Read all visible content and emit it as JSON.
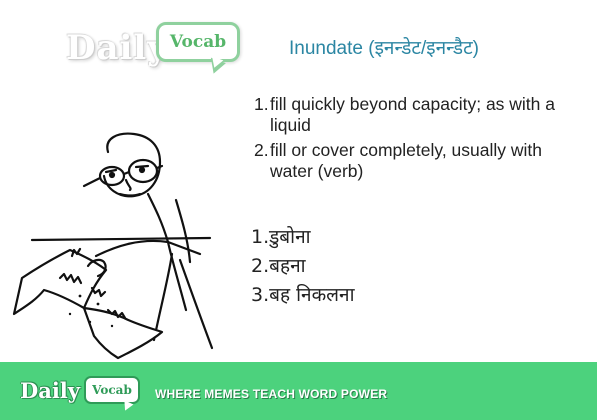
{
  "brand": {
    "daily": "Daily",
    "vocab": "Vocab",
    "tagline": "WHERE MEMES TEACH WORD POWER"
  },
  "headword": "Inundate (इनन्डेट/इनन्डैट)",
  "definitions": [
    {
      "num": "1.",
      "text": "fill quickly beyond capacity; as with a liquid"
    },
    {
      "num": "2.",
      "text": "fill or cover completely, usually with water (verb)"
    }
  ],
  "hindi_meanings": [
    "1.डुबोना",
    "2.बहना",
    "3.बह  निकलना"
  ],
  "icons": {
    "illustration": "meme-stick-figure-holding-paper-icon",
    "chat_bubble": "speech-bubble-icon"
  },
  "colors": {
    "footer_green": "#4cd27d",
    "headword_blue": "#2b86a3",
    "logo_green": "#56b66a"
  }
}
